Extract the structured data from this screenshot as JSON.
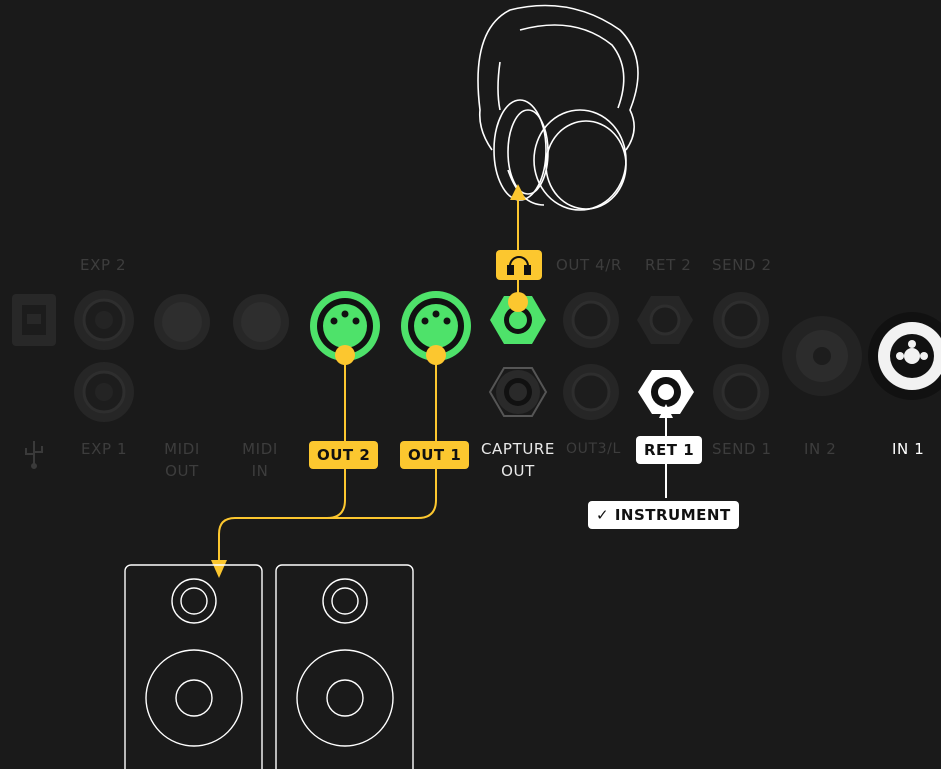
{
  "ports_top_labels": {
    "exp2": "EXP 2",
    "out4r": "OUT 4/R",
    "ret2": "RET 2",
    "send2": "SEND 2"
  },
  "ports_bottom_labels": {
    "exp1": "EXP 1",
    "midi_out_1": "MIDI",
    "midi_out_2": "OUT",
    "midi_in_1": "MIDI",
    "midi_in_2": "IN",
    "capture_out_1": "CAPTURE",
    "capture_out_2": "OUT",
    "out3l": "OUT3/L",
    "send1": "SEND 1",
    "in2": "IN 2",
    "in1": "IN 1"
  },
  "badges": {
    "out2": "OUT 2",
    "out1": "OUT 1",
    "ret1": "RET 1",
    "instrument": "INSTRUMENT"
  },
  "colors": {
    "background": "#1a1a1a",
    "highlight_yellow": "#fcc72f",
    "active_green": "#4ee26a",
    "dim_port": "#2a2a2a",
    "outline_white": "#ffffff"
  }
}
